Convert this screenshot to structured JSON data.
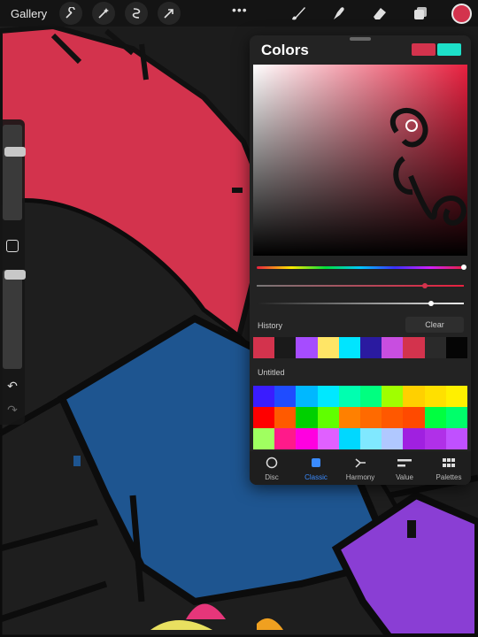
{
  "toolbar": {
    "gallery_label": "Gallery",
    "left_icons": [
      "wrench-icon",
      "magic-wand-icon",
      "selection-icon",
      "transform-arrow-icon"
    ],
    "more_label": "•••",
    "right_icons": [
      "brush-icon",
      "smudge-icon",
      "eraser-icon",
      "layers-icon"
    ],
    "current_color": "#d3334d"
  },
  "colors_panel": {
    "title": "Colors",
    "primary_color": "#d3334d",
    "secondary_color": "#1de0c9",
    "hue_value": 1.0,
    "saturation_value": 0.81,
    "brightness_value": 0.84,
    "history_label": "History",
    "clear_label": "Clear",
    "history_colors": [
      "#d3334d",
      "#1a1a1a",
      "#a64cff",
      "#ffe566",
      "#00e5ff",
      "#2a1aa0",
      "#c84ee0",
      "#d3334d",
      "#2a2a2a",
      "#050505"
    ],
    "palette_name": "Untitled",
    "palette_colors": [
      "#3a1cff",
      "#1f4cff",
      "#00b8ff",
      "#00e8ff",
      "#00ffb0",
      "#00ff80",
      "#a0ff00",
      "#ffd000",
      "#ffe000",
      "#fff000",
      "#ff0000",
      "#ff5a00",
      "#00d000",
      "#60ff00",
      "#ff8000",
      "#ff6a00",
      "#ff5800",
      "#ff4a00",
      "#00ff40",
      "#00ff6a",
      "#a0ff60",
      "#ff1a8a",
      "#ff00e0",
      "#e060ff",
      "#00d8ff",
      "#80e8ff",
      "#b0c8ff",
      "#a020e0",
      "#b030e8",
      "#c050ff"
    ],
    "tabs": [
      {
        "label": "Disc",
        "icon": "disc-icon",
        "active": false
      },
      {
        "label": "Classic",
        "icon": "classic-square-icon",
        "active": true
      },
      {
        "label": "Harmony",
        "icon": "harmony-icon",
        "active": false
      },
      {
        "label": "Value",
        "icon": "value-sliders-icon",
        "active": false
      },
      {
        "label": "Palettes",
        "icon": "palettes-grid-icon",
        "active": false
      }
    ]
  },
  "sidebar": {
    "brush_size": 0.74,
    "opacity": 1.0,
    "modifier_icon": "modifier-square-icon",
    "undo_icon": "undo-icon",
    "redo_icon": "redo-icon"
  }
}
